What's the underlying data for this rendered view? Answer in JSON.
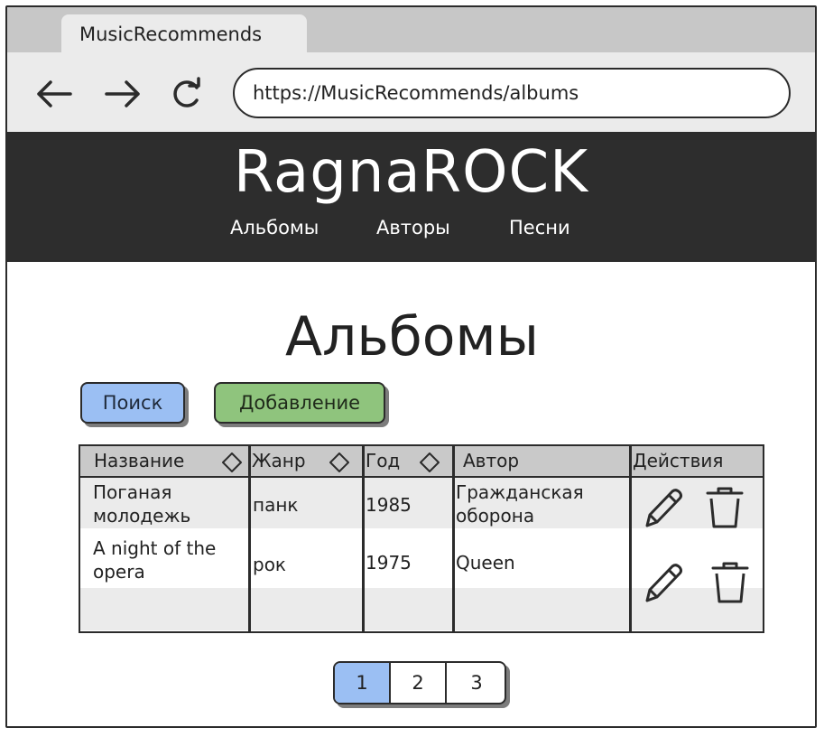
{
  "browser": {
    "tab_title": "MusicRecommends",
    "url": "https://MusicRecommends/albums"
  },
  "header": {
    "logo": "RagnaROCK",
    "menu": [
      "Альбомы",
      "Авторы",
      "Песни"
    ]
  },
  "page": {
    "title": "Альбомы",
    "search_button": "Поиск",
    "add_button": "Добавление"
  },
  "table": {
    "columns": [
      "Название",
      "Жанр",
      "Год",
      "Автор",
      "Действия"
    ],
    "rows": [
      {
        "name": "Поганая молодежь",
        "genre": "панк",
        "year": "1985",
        "author": "Гражданская оборона"
      },
      {
        "name": "A night of the opera",
        "genre": "рок",
        "year": "1975",
        "author": "Queen"
      }
    ]
  },
  "pagination": {
    "pages": [
      "1",
      "2",
      "3"
    ],
    "current": "1"
  },
  "colors": {
    "primary_blue": "#9bbff3",
    "add_green": "#8fc47d",
    "header_dark": "#2d2d2d"
  }
}
